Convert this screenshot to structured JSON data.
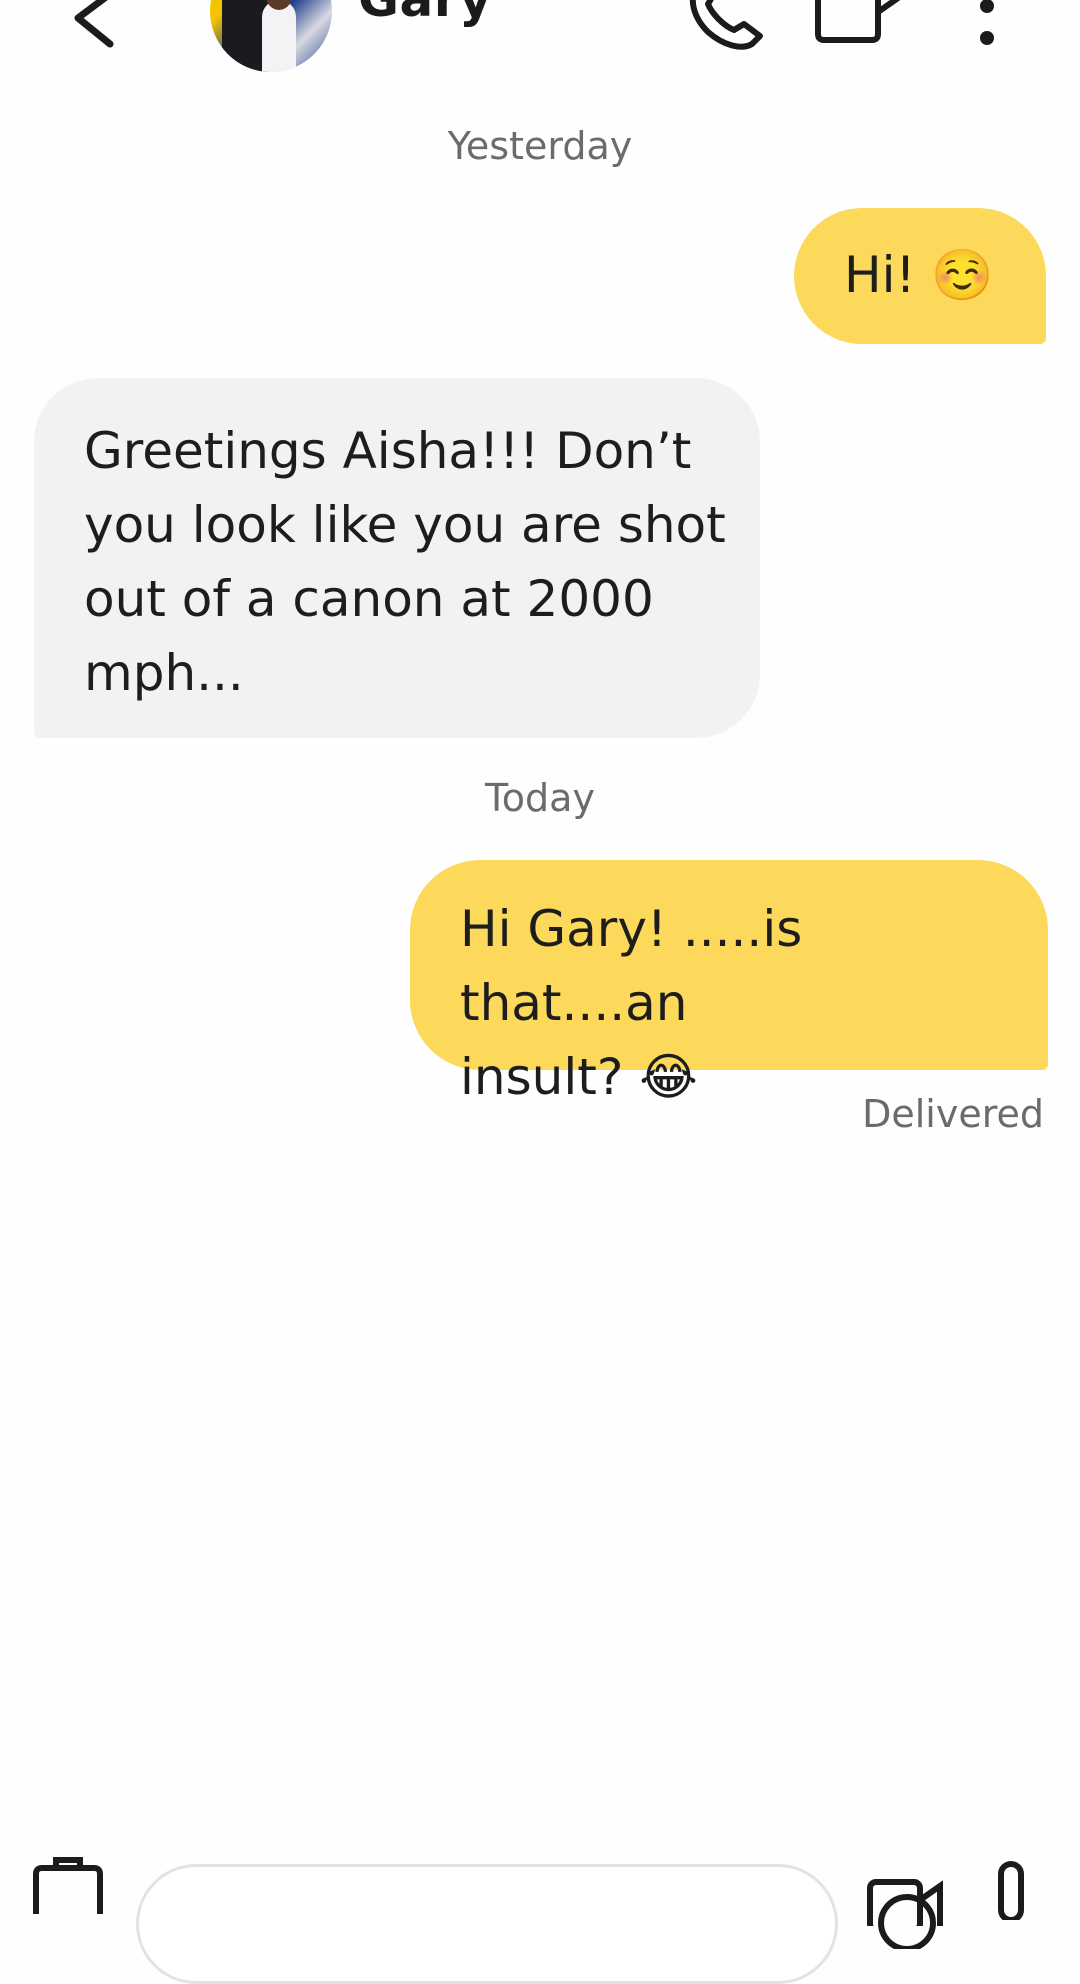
{
  "header": {
    "contact_name": "Gary",
    "icons": [
      "chevron-left-icon",
      "phone-icon",
      "video-camera-icon",
      "more-vertical-icon"
    ]
  },
  "messages": [
    {
      "type": "date",
      "text": "Yesterday"
    },
    {
      "type": "outgoing",
      "text": "Hi! ☺️"
    },
    {
      "type": "incoming",
      "lines": [
        "Greetings Aisha!!!  Don’t",
        "you look like you are shot",
        "out of a canon at 2000",
        "mph..."
      ]
    },
    {
      "type": "date",
      "text": "Today"
    },
    {
      "type": "outgoing",
      "lines": [
        "Hi Gary! .....is that....an",
        "insult? 😂"
      ]
    },
    {
      "type": "status",
      "text": "Delivered"
    }
  ],
  "colors": {
    "outgoing_bubble": "#fcd95a",
    "incoming_bubble": "#f2f2f2",
    "meta_text": "#6b6b6b"
  },
  "composer": {
    "icons": [
      "attachment-icon",
      "emoji-icon",
      "video-message-icon",
      "microphone-icon"
    ]
  }
}
